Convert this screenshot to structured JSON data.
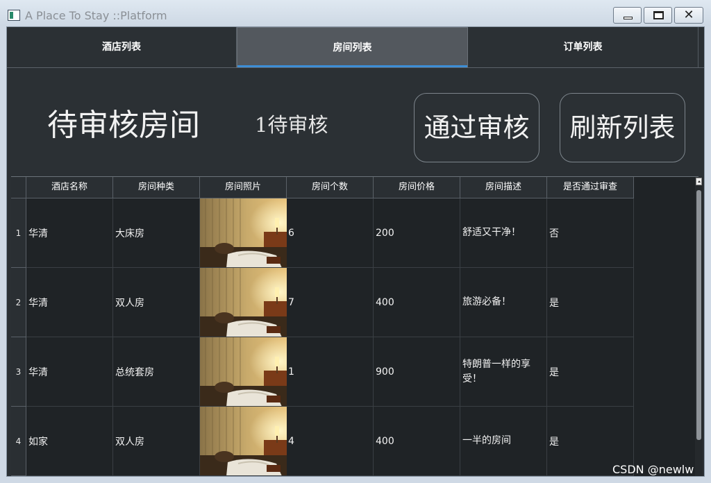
{
  "window": {
    "title": "A Place To Stay ::Platform",
    "min_glyph": "",
    "max_glyph": "",
    "close_glyph": "✕"
  },
  "tabs": [
    {
      "label": "酒店列表",
      "selected": false
    },
    {
      "label": "房间列表",
      "selected": true
    },
    {
      "label": "订单列表",
      "selected": false
    }
  ],
  "header": {
    "title": "待审核房间",
    "pending_count": "1待审核",
    "approve_label": "通过审核",
    "refresh_label": "刷新列表"
  },
  "table": {
    "columns": [
      "酒店名称",
      "房间种类",
      "房间照片",
      "房间个数",
      "房间价格",
      "房间描述",
      "是否通过审查"
    ],
    "rows": [
      {
        "num": "1",
        "hotel": "华清",
        "type": "大床房",
        "count": "6",
        "price": "200",
        "desc": "舒适又干净！",
        "approved": "否"
      },
      {
        "num": "2",
        "hotel": "华清",
        "type": "双人房",
        "count": "7",
        "price": "400",
        "desc": "旅游必备！",
        "approved": "是"
      },
      {
        "num": "3",
        "hotel": "华清",
        "type": "总统套房",
        "count": "1",
        "price": "900",
        "desc": "特朗普一样的享受！",
        "approved": "是"
      },
      {
        "num": "4",
        "hotel": "如家",
        "type": "双人房",
        "count": "4",
        "price": "400",
        "desc": "一半的房间",
        "approved": "是"
      }
    ]
  },
  "watermark": "CSDN @newlw",
  "colors": {
    "background": "#2b3034",
    "selected_tab": "#53585e",
    "tab_indicator": "#3d8ed6"
  }
}
